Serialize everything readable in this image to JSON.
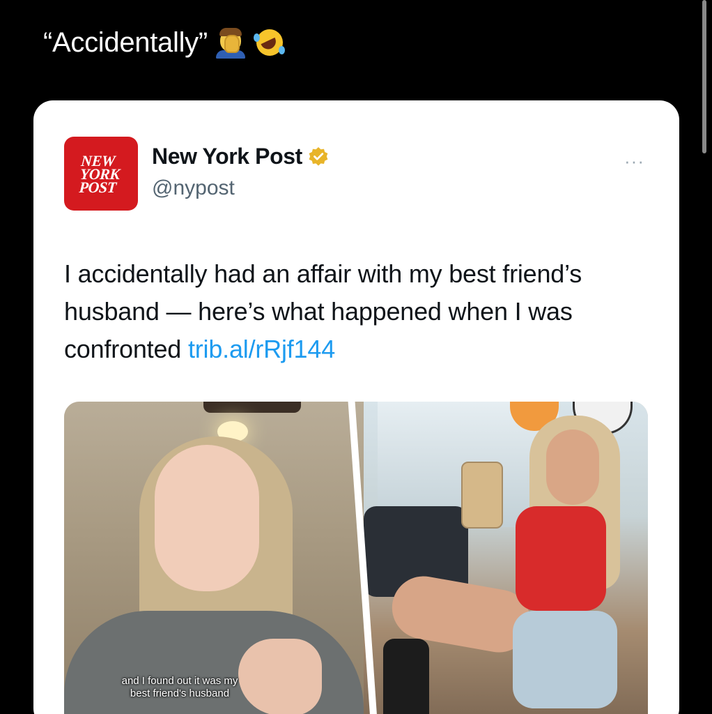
{
  "caption": {
    "text": "“Accidentally”",
    "emojis": [
      "facepalm-emoji",
      "rolling-on-floor-laughing-emoji"
    ]
  },
  "tweet": {
    "account": {
      "display_name": "New York Post",
      "handle": "@nypost",
      "verified_badge": "gold-verified-icon",
      "avatar_logo_lines": [
        "NEW",
        "YORK",
        "POST"
      ],
      "avatar_color": "#d41a1f"
    },
    "more_menu": "···",
    "text": "I accidentally had an affair with my best friend’s husband — here’s what happened when I was confronted ",
    "link": "trib.al/rRjf144",
    "media": {
      "left_subtitle_line1": "and I found out it was my",
      "left_subtitle_line2": "best friend's husband"
    }
  },
  "colors": {
    "background": "#000000",
    "card": "#ffffff",
    "link": "#1d9bf0",
    "secondary_text": "#536471",
    "verified_gold": "#e8b429"
  }
}
